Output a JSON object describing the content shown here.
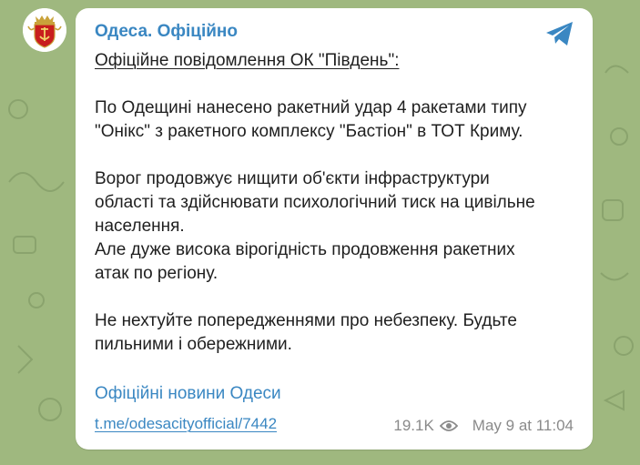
{
  "channel": {
    "name": "Одеса. Офіційно"
  },
  "message": {
    "heading": "Офіційне повідомлення ОК \"Південь\":",
    "para1_line1": "По Одещині нанесено ракетний удар 4 ракетами типу",
    "para1_line2": "\"Онікс\" з ракетного комплексу \"Бастіон\" в ТОТ Криму.",
    "para2_line1": "Ворог продовжує нищити об'єкти інфраструктури",
    "para2_line2": "області та здійснювати психологічний тиск на цивільне",
    "para2_line3": "населення.",
    "para3_line1": "Але дуже висока вірогідність продовження ракетних",
    "para3_line2": "атак по регіону.",
    "para4_line1": "Не нехтуйте попередженнями про небезпеку. Будьте",
    "para4_line2": "пильними і обережними.",
    "signature": "Офіційні новини Одеси",
    "link": "t.me/odesacityofficial/7442"
  },
  "meta": {
    "views": "19.1K",
    "timestamp": "May 9 at 11:04"
  },
  "icons": {
    "share": "telegram-send-icon",
    "views": "eye-icon",
    "avatar": "odesa-coat-of-arms"
  },
  "colors": {
    "accent": "#3a87c2",
    "background": "#9fb87f",
    "bubble": "#ffffff",
    "text": "#1f1f1f",
    "meta": "#8a8a8a"
  }
}
